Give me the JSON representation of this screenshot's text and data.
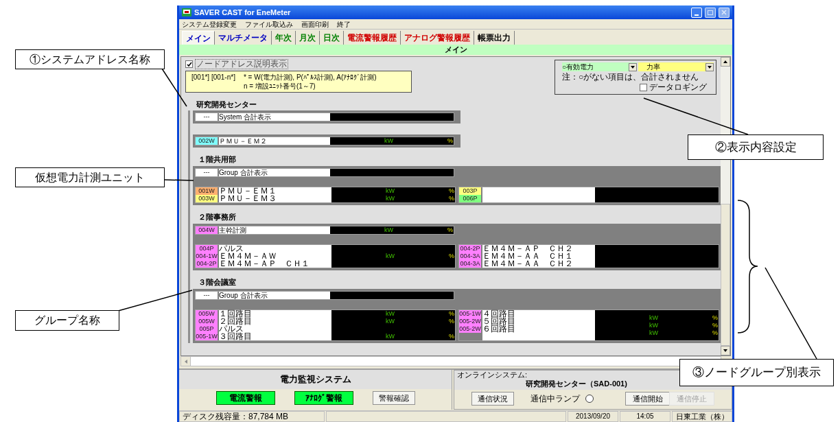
{
  "window": {
    "title": "SAVER CAST for EneMeter"
  },
  "menu": [
    "システム登録変更",
    "ファイル取込み",
    "画面印刷",
    "終了"
  ],
  "tabs": [
    {
      "label": "メイン",
      "color": "#0000c0",
      "selected": true
    },
    {
      "label": "マルチメータ",
      "color": "#0000c0",
      "selected": false
    },
    {
      "label": "年次",
      "color": "#008000",
      "selected": false
    },
    {
      "label": "月次",
      "color": "#008000",
      "selected": false
    },
    {
      "label": "日次",
      "color": "#008000",
      "selected": false
    },
    {
      "label": "電流警報履歴",
      "color": "#d00000",
      "selected": false
    },
    {
      "label": "アナログ警報履歴",
      "color": "#d00000",
      "selected": false
    },
    {
      "label": "帳票出力",
      "color": "#000000",
      "selected": false
    }
  ],
  "page_header": "メイン",
  "address_legend": {
    "checkbox": {
      "label": "ノードアドレス説明表示",
      "checked": true
    },
    "format": "[001*]  [001-n*]",
    "lines": [
      "* = W(電力計測), P(ﾊﾟﾙｽ計測), A(ｱﾅﾛｸﾞ計測)",
      "n = 増設ﾕﾆｯﾄ番号(1～7)"
    ]
  },
  "display_settings": {
    "selects": [
      {
        "value": "○有効電力",
        "color": "#c0ffc0"
      },
      {
        "value": "力率",
        "color": "#ffff80"
      }
    ],
    "note": "注：○がない項目は、合計されません",
    "logging": {
      "label": "データロギング",
      "checked": false
    }
  },
  "system": {
    "title": "研究開発センター",
    "rows": [
      {
        "kind": "total",
        "code": "---",
        "label": "System 合計表示"
      },
      {
        "kind": "meter",
        "code": "002W",
        "color": "#80ffff",
        "name": "ＰＭＵ－ＥＭ２",
        "unit": "kW",
        "pct": "%"
      }
    ]
  },
  "groups": [
    {
      "title": "１階共用部",
      "header": {
        "kind": "total",
        "code": "---",
        "label": "Group 合計表示"
      },
      "units": [
        [
          {
            "code": "001W",
            "color": "#ffb070",
            "name": "ＰＭＵ－ＥＭ１",
            "unit": "kW",
            "pct": "%"
          },
          {
            "code": "003W",
            "color": "#ffff80",
            "name": "ＰＭＵ－ＥＭ３",
            "unit": "kW",
            "pct": "%"
          }
        ],
        [
          {
            "code": "003P",
            "color": "#ffff80"
          },
          {
            "code": "006P",
            "color": "#80ff80"
          }
        ]
      ]
    },
    {
      "title": "２階事務所",
      "header": {
        "kind": "meter",
        "code": "004W",
        "color": "#ff80ff",
        "name": "主幹計測",
        "unit": "kW",
        "pct": "%"
      },
      "units": [
        [
          {
            "code": "004P",
            "color": "#ff80ff",
            "name": "パルス"
          },
          {
            "code": "004-1W",
            "color": "#ff80ff",
            "name": "ＥＭ４Ｍ－ＡＷ",
            "unit": "kW",
            "pct": "%"
          },
          {
            "code": "004-2P",
            "color": "#ff80ff",
            "name": "ＥＭ４Ｍ－ＡＰ　ＣＨ１"
          }
        ],
        [
          {
            "code": "004-2P",
            "color": "#ff80ff",
            "name": "ＥＭ４Ｍ－ＡＰ　ＣＨ２"
          },
          {
            "code": "004-3A",
            "color": "#ff80ff",
            "name": "ＥＭ４Ｍ－ＡＡ　ＣＨ１"
          },
          {
            "code": "004-3A",
            "color": "#ff80ff",
            "name": "ＥＭ４Ｍ－ＡＡ　ＣＨ２"
          }
        ]
      ]
    },
    {
      "title": "３階会議室",
      "header": {
        "kind": "total",
        "code": "---",
        "label": "Group 合計表示"
      },
      "units": [
        [
          {
            "code": "005W",
            "color": "#ff80ff",
            "name": "１回路目",
            "unit": "kW",
            "pct": "%"
          },
          {
            "code": "005W",
            "color": "#ff80ff",
            "name": "２回路目",
            "unit": "kW",
            "pct": "%"
          },
          {
            "code": "005P",
            "color": "#ff80ff",
            "name": "パルス"
          },
          {
            "code": "005-1W",
            "color": "#ff80ff",
            "name": "３回路目",
            "unit": "kW",
            "pct": "%"
          }
        ],
        [
          {
            "code": "005-1W",
            "color": "#ff80ff",
            "name": "４回路目",
            "unit": "kW",
            "pct": "%"
          },
          {
            "code": "005-2W",
            "color": "#ff80ff",
            "name": "５回路目",
            "unit": "kW",
            "pct": "%"
          },
          {
            "code": "005-2W",
            "color": "#ff80ff",
            "name": "６回路目",
            "unit": "kW",
            "pct": "%"
          }
        ]
      ]
    }
  ],
  "monitor_panel": {
    "title": "電力監視システム",
    "buttons": [
      {
        "label": "電流警報",
        "kind": "alarm"
      },
      {
        "label": "ｱﾅﾛｸﾞ警報",
        "kind": "alarm"
      },
      {
        "label": "警報確認",
        "kind": "plain"
      }
    ]
  },
  "online_panel": {
    "label": "オンラインシステム:",
    "system": "研究開発センター（SAD-001)",
    "status_button": "通信状況",
    "lamp": {
      "label": "通信中ランプ",
      "on": false
    },
    "buttons": [
      {
        "label": "通信開始",
        "disabled": false
      },
      {
        "label": "通信停止",
        "disabled": true
      }
    ]
  },
  "status_bar": [
    "ディスク残容量：87,784 MB",
    "2013/09/20",
    "14:05",
    "日東工業（株）"
  ],
  "callouts": [
    "①システムアドレス名称",
    "仮想電力計測ユニット",
    "グループ名称",
    "②表示内容設定",
    "③ノードグループ別表示"
  ]
}
